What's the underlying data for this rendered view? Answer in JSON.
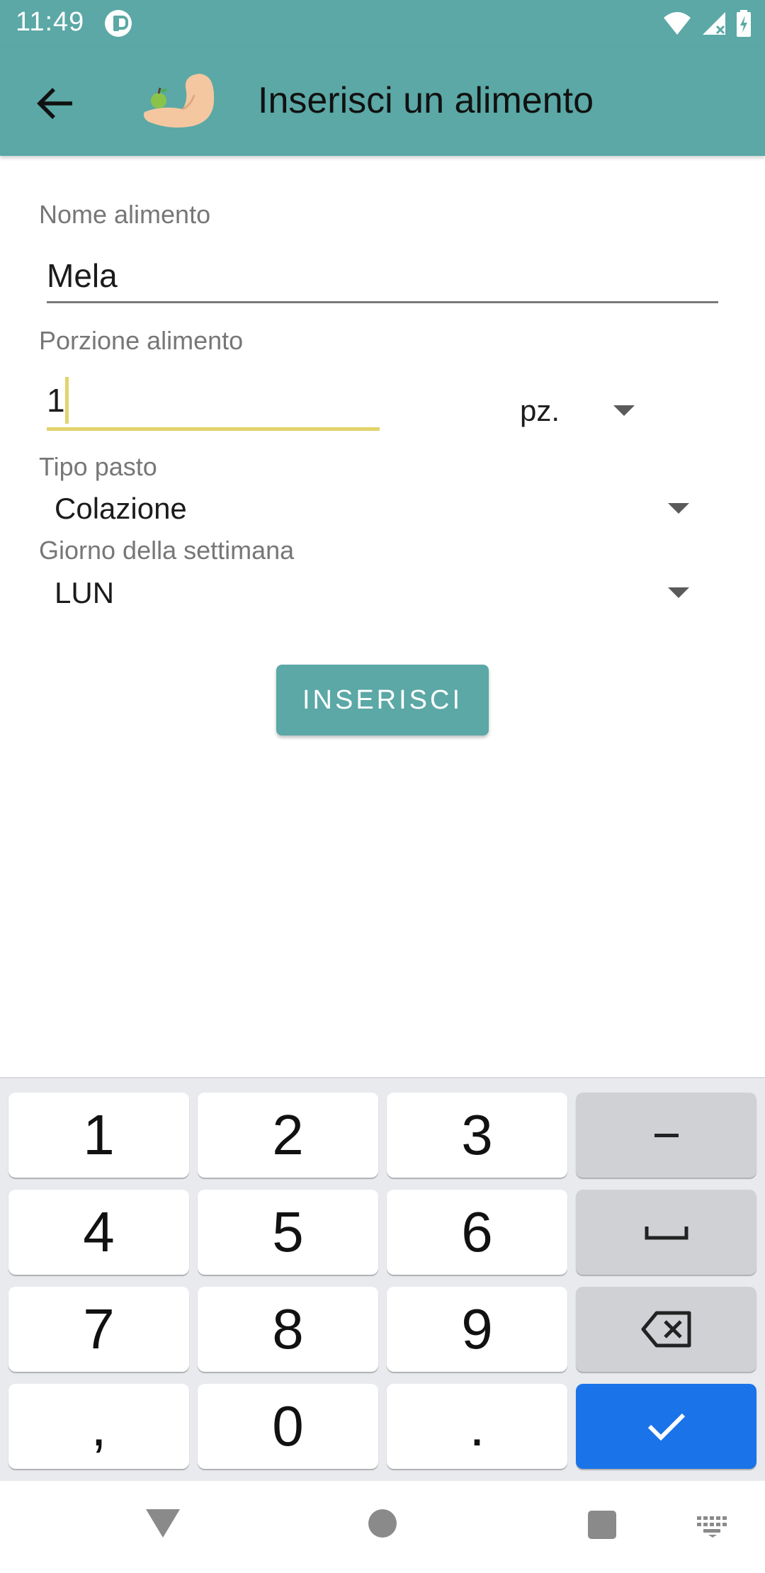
{
  "status_bar": {
    "time": "11:49",
    "icons": [
      "app-notification-icon",
      "wifi-icon",
      "signal-icon",
      "battery-charging-icon"
    ]
  },
  "app_bar": {
    "back_icon": "arrow-left-icon",
    "logo_icon": "arm-with-apple-logo",
    "title": "Inserisci un alimento"
  },
  "form": {
    "food_name": {
      "label": "Nome alimento",
      "value": "Mela"
    },
    "portion": {
      "label": "Porzione alimento",
      "value": "1",
      "unit": "pz."
    },
    "meal_type": {
      "label": "Tipo pasto",
      "value": "Colazione"
    },
    "weekday": {
      "label": "Giorno della settimana",
      "value": "LUN"
    },
    "submit_label": "INSERISCI"
  },
  "keyboard": {
    "keys": [
      "1",
      "2",
      "3",
      "–",
      "4",
      "5",
      "6",
      "␣",
      "7",
      "8",
      "9",
      "⌫",
      ",",
      "0",
      ".",
      "✓"
    ]
  },
  "colors": {
    "accent": "#5ba8a6",
    "focus_underline": "#e3d36a",
    "keyboard_done": "#1a73e8"
  }
}
